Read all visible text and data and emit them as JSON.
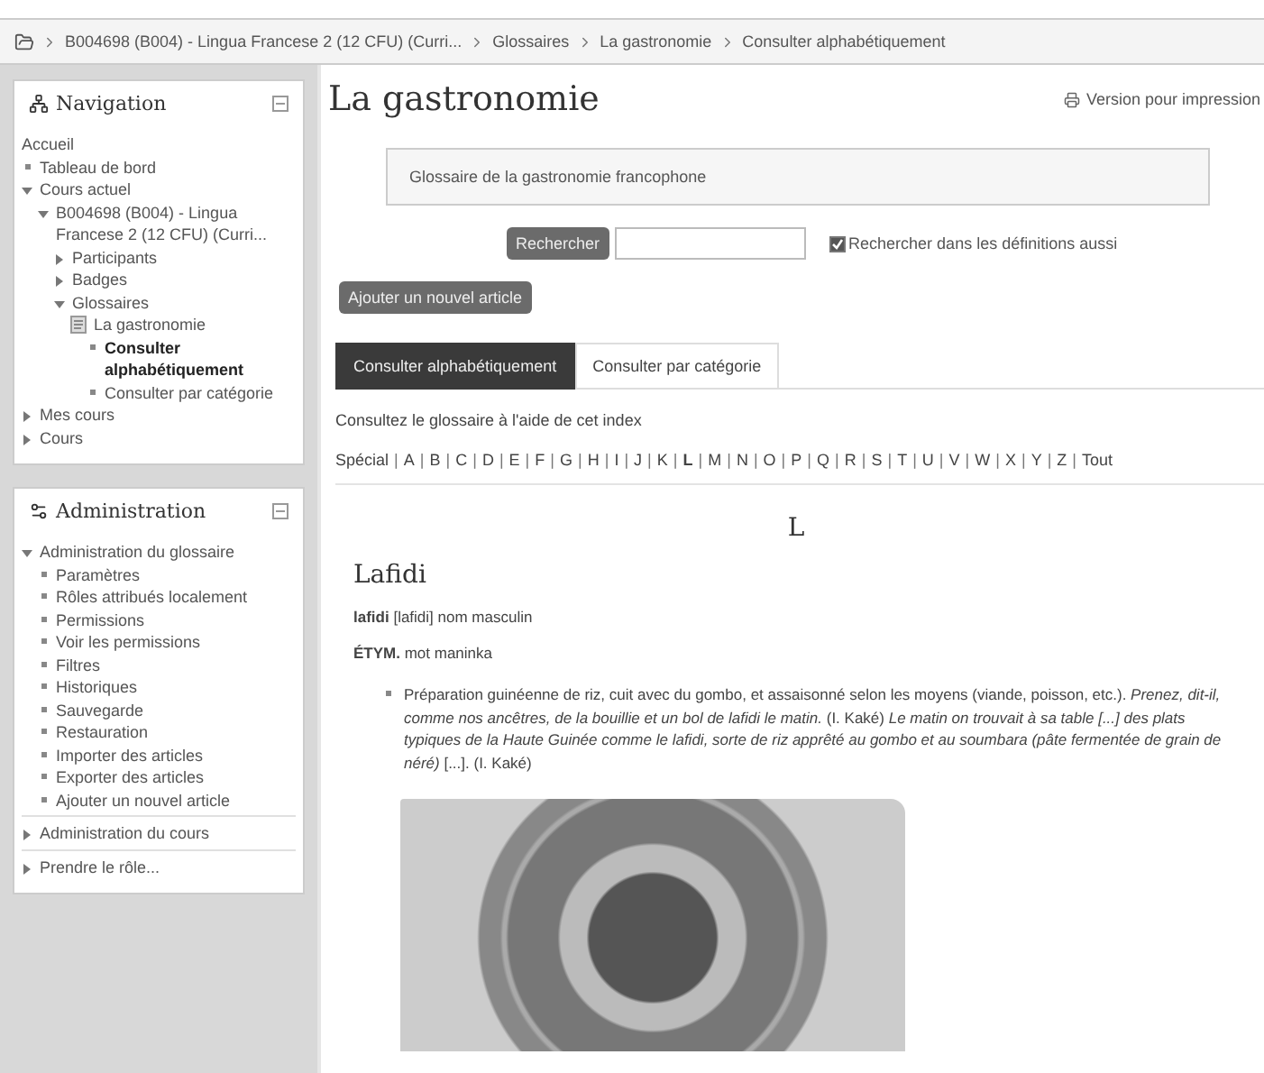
{
  "breadcrumb": {
    "items": [
      "B004698 (B004) - Lingua Francese 2 (12 CFU) (Curri...",
      "Glossaires",
      "La gastronomie",
      "Consulter alphabétiquement"
    ]
  },
  "navigation": {
    "title": "Navigation",
    "items": [
      {
        "kind": "plain",
        "text": "Accueil",
        "selected": false
      },
      {
        "kind": "link",
        "text": "Tableau de bord",
        "selected": false
      },
      {
        "kind": "branch",
        "text": "Cours actuel",
        "expanded": true,
        "selected": false,
        "children": [
          {
            "kind": "branch",
            "text": "B004698 (B004) - Lingua Francese 2 (12 CFU) (Curri...",
            "expanded": true,
            "selected": false,
            "children": [
              {
                "kind": "branch",
                "text": "Participants",
                "expanded": false,
                "selected": false
              },
              {
                "kind": "branch",
                "text": "Badges",
                "expanded": false,
                "selected": false
              },
              {
                "kind": "branch",
                "text": "Glossaires",
                "expanded": true,
                "selected": false,
                "children": [
                  {
                    "kind": "resource",
                    "text": "La gastronomie",
                    "selected": false,
                    "children": [
                      {
                        "kind": "link",
                        "text": "Consulter alphabétiquement",
                        "selected": true
                      },
                      {
                        "kind": "link",
                        "text": "Consulter par catégorie",
                        "selected": false
                      }
                    ]
                  }
                ]
              }
            ]
          }
        ]
      },
      {
        "kind": "branch",
        "text": "Mes cours",
        "expanded": false,
        "selected": false
      },
      {
        "kind": "branch",
        "text": "Cours",
        "expanded": false,
        "selected": false
      }
    ]
  },
  "administration": {
    "title": "Administration",
    "items": [
      {
        "kind": "branch",
        "text": "Administration du glossaire",
        "expanded": true,
        "selected": false,
        "children": [
          {
            "kind": "link",
            "text": "Paramètres",
            "selected": false
          },
          {
            "kind": "link",
            "text": "Rôles attribués localement",
            "selected": false
          },
          {
            "kind": "link",
            "text": "Permissions",
            "selected": false
          },
          {
            "kind": "link",
            "text": "Voir les permissions",
            "selected": false
          },
          {
            "kind": "link",
            "text": "Filtres",
            "selected": false
          },
          {
            "kind": "link",
            "text": "Historiques",
            "selected": false
          },
          {
            "kind": "link",
            "text": "Sauvegarde",
            "selected": false
          },
          {
            "kind": "link",
            "text": "Restauration",
            "selected": false
          },
          {
            "kind": "link",
            "text": "Importer des articles",
            "selected": false
          },
          {
            "kind": "link",
            "text": "Exporter des articles",
            "selected": false
          },
          {
            "kind": "link",
            "text": "Ajouter un nouvel article",
            "selected": false
          }
        ]
      },
      {
        "kind": "branch",
        "text": "Administration du cours",
        "expanded": false,
        "selected": false
      },
      {
        "kind": "branch",
        "text": "Prendre le rôle...",
        "expanded": false,
        "selected": false
      }
    ]
  },
  "page": {
    "title": "La gastronomie",
    "print_link": "Version pour impression",
    "description": "Glossaire de la gastronomie francophone",
    "search": {
      "button": "Rechercher",
      "checkbox": {
        "label": "Rechercher dans les définitions aussi",
        "checked": true
      }
    },
    "add_button": "Ajouter un nouvel article",
    "tabs": [
      {
        "label": "Consulter alphabétiquement",
        "selected": true
      },
      {
        "label": "Consulter par catégorie",
        "selected": false
      }
    ],
    "index_hint": "Consultez le glossaire à l'aide de cet index",
    "alphabet": {
      "separator": "|",
      "letters": [
        {
          "label": "Spécial",
          "selected": false
        },
        {
          "label": "A",
          "selected": false
        },
        {
          "label": "B",
          "selected": false
        },
        {
          "label": "C",
          "selected": false
        },
        {
          "label": "D",
          "selected": false
        },
        {
          "label": "E",
          "selected": false
        },
        {
          "label": "F",
          "selected": false
        },
        {
          "label": "G",
          "selected": false
        },
        {
          "label": "H",
          "selected": false
        },
        {
          "label": "I",
          "selected": false
        },
        {
          "label": "J",
          "selected": false
        },
        {
          "label": "K",
          "selected": false
        },
        {
          "label": "L",
          "selected": true
        },
        {
          "label": "M",
          "selected": false
        },
        {
          "label": "N",
          "selected": false
        },
        {
          "label": "O",
          "selected": false
        },
        {
          "label": "P",
          "selected": false
        },
        {
          "label": "Q",
          "selected": false
        },
        {
          "label": "R",
          "selected": false
        },
        {
          "label": "S",
          "selected": false
        },
        {
          "label": "T",
          "selected": false
        },
        {
          "label": "U",
          "selected": false
        },
        {
          "label": "V",
          "selected": false
        },
        {
          "label": "W",
          "selected": false
        },
        {
          "label": "X",
          "selected": false
        },
        {
          "label": "Y",
          "selected": false
        },
        {
          "label": "Z",
          "selected": false
        },
        {
          "label": "Tout",
          "selected": false
        }
      ]
    },
    "letter_heading": "L",
    "entry": {
      "term": "Lafidi",
      "lines": [
        "**lafidi** [lafidi] nom masculin",
        "**ÉTYM.** mot maninka"
      ],
      "definitions": [
        "Préparation guinéenne de riz, cuit avec du gombo, et assaisonné selon les moyens (viande, poisson, etc.). *Prenez, dit-il, comme nos ancêtres, de la bouillie et un bol de lafidi le matin.* (I. Kaké) *Le matin on trouvait à sa table [...] des plats typiques de la Haute Guinée comme le lafidi, sorte de riz apprêté au gombo et au soumbara (pâte fermentée de grain de néré)* [...]. (I. Kaké)"
      ]
    }
  }
}
